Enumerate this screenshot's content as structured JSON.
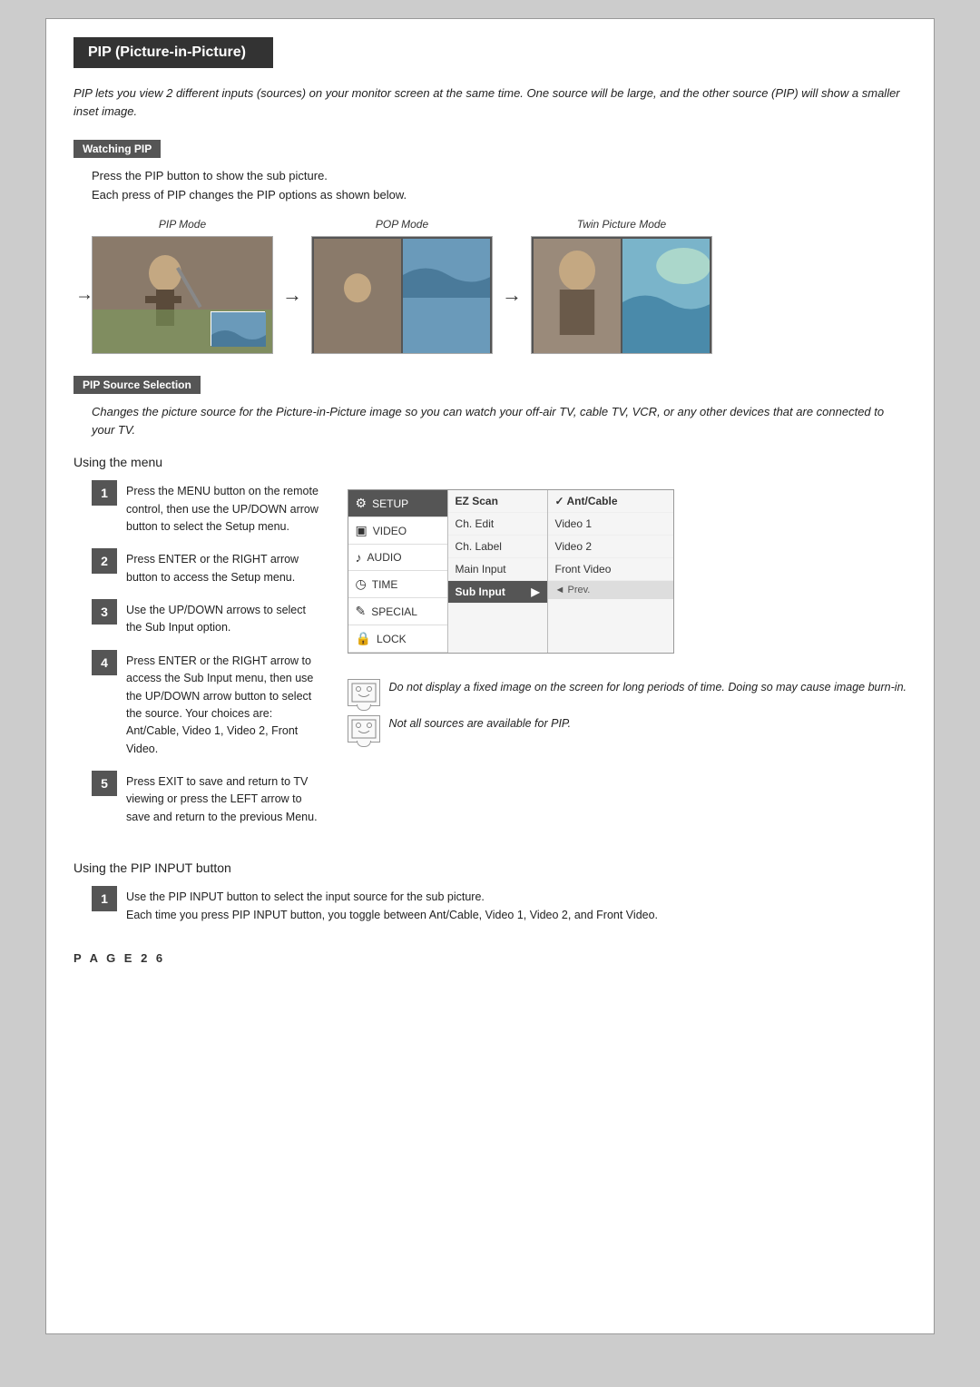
{
  "page": {
    "title": "PIP (Picture-in-Picture)",
    "intro": "PIP lets you view 2 different inputs (sources) on your monitor screen at the same time. One source will be large, and the other source (PIP) will show a smaller inset image.",
    "watching_pip": {
      "label": "Watching PIP",
      "line1": "Press the PIP button to show the sub picture.",
      "line2": "Each press of PIP changes the PIP options as shown below.",
      "pip_mode_label": "PIP Mode",
      "pop_mode_label": "POP Mode",
      "twin_mode_label": "Twin Picture Mode"
    },
    "pip_source": {
      "label": "PIP Source Selection",
      "description": "Changes the picture source for the Picture-in-Picture image so you can watch your off-air TV, cable TV, VCR, or any other devices that are connected to your TV.",
      "using_menu": "Using the menu",
      "steps": [
        {
          "num": "1",
          "text": "Press the MENU button on the remote control, then use the UP/DOWN arrow button to select the Setup menu."
        },
        {
          "num": "2",
          "text": "Press ENTER or the RIGHT arrow button to access the Setup menu."
        },
        {
          "num": "3",
          "text": "Use the UP/DOWN arrows to select the Sub Input option."
        },
        {
          "num": "4",
          "text": "Press ENTER or the RIGHT arrow to access the Sub Input menu, then use the UP/DOWN arrow button to select the source. Your choices are: Ant/Cable, Video 1, Video 2, Front Video."
        },
        {
          "num": "5",
          "text": "Press EXIT to save and return to TV viewing or press the LEFT arrow to save and return to the previous Menu."
        }
      ],
      "menu": {
        "items": [
          {
            "icon": "⚙",
            "label": "SETUP",
            "active": true
          },
          {
            "icon": "□",
            "label": "VIDEO",
            "active": false
          },
          {
            "icon": "🔊",
            "label": "AUDIO",
            "active": false
          },
          {
            "icon": "⏰",
            "label": "TIME",
            "active": false
          },
          {
            "icon": "✏",
            "label": "SPECIAL",
            "active": false
          },
          {
            "icon": "🔒",
            "label": "LOCK",
            "active": false
          }
        ],
        "center_items": [
          {
            "label": "EZ Scan",
            "active": false,
            "bold": false
          },
          {
            "label": "Ch. Edit",
            "active": false,
            "bold": false
          },
          {
            "label": "Ch. Label",
            "active": false,
            "bold": false
          },
          {
            "label": "Main Input",
            "active": false,
            "bold": false
          },
          {
            "label": "Sub Input",
            "active": true,
            "bold": true
          }
        ],
        "right_items": [
          {
            "label": "Ant/Cable",
            "checkmark": true
          },
          {
            "label": "Video 1",
            "checkmark": false
          },
          {
            "label": "Video 2",
            "checkmark": false
          },
          {
            "label": "Front Video",
            "checkmark": false
          }
        ],
        "prev_label": "◄ Prev."
      },
      "note1": "Do not display a fixed image on the screen for long periods of time. Doing so may cause image burn-in.",
      "note2": "Not all sources are available for PIP."
    },
    "pip_input": {
      "label": "Using the PIP INPUT button",
      "step1_num": "1",
      "step1_text": "Use the PIP INPUT button to select the input source for the sub picture.\nEach time you press PIP INPUT button, you toggle between Ant/Cable, Video 1, Video 2, and Front Video."
    },
    "footer": "P A G E   2 6"
  }
}
